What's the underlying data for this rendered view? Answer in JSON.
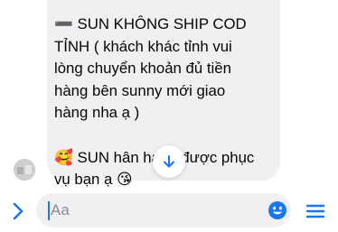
{
  "message": {
    "text": "➖ SUN KHÔNG SHIP COD\nTỈNH ( khách khác tỉnh vui\nlòng chuyển khoản đủ tiền\nhàng bên sunny mới giao\nhàng nha ạ )\n\n🥰 SUN hân hạnh được phục\nvụ bạn ạ 😘"
  },
  "composer": {
    "placeholder": "Aa"
  },
  "icons": {
    "expand": "chevron-right-icon",
    "scroll_down": "arrow-down-icon",
    "emoji": "emoji-smile-icon",
    "menu": "menu-icon"
  },
  "colors": {
    "accent": "#1877f2",
    "bubble": "#f0f0f2"
  }
}
